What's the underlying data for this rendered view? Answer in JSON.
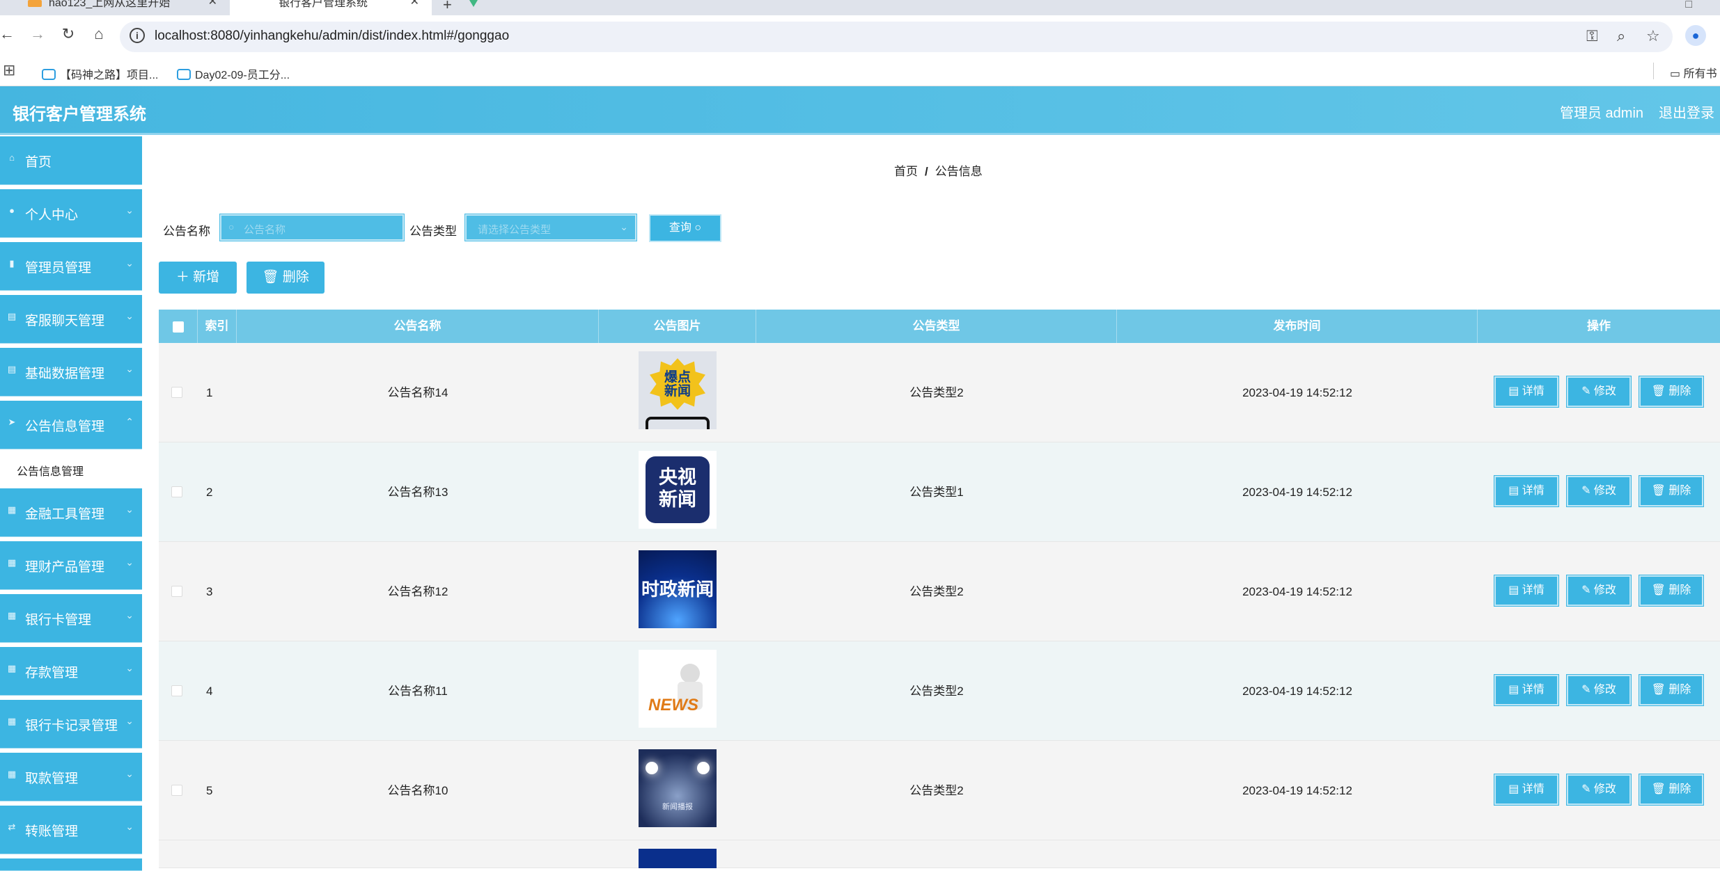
{
  "browser": {
    "tabs": [
      {
        "title": "hao123_上网从这里开始"
      },
      {
        "title": "银行客户管理系统"
      }
    ],
    "url": "localhost:8080/yinhangkehu/admin/dist/index.html#/gonggao",
    "bookmarks": [
      "【码神之路】项目...",
      "Day02-09-员工分..."
    ],
    "bookmarks_all": "所有书"
  },
  "header": {
    "title": "银行客户管理系统",
    "user": "管理员 admin",
    "logout": "退出登录"
  },
  "sidebar": {
    "items": [
      {
        "label": "首页",
        "icon": "home-icon"
      },
      {
        "label": "个人中心",
        "icon": "user-icon"
      },
      {
        "label": "管理员管理",
        "icon": "bar-chart-icon"
      },
      {
        "label": "客服聊天管理",
        "icon": "document-icon"
      },
      {
        "label": "基础数据管理",
        "icon": "document-icon"
      },
      {
        "label": "公告信息管理",
        "icon": "send-icon"
      },
      {
        "label": "金融工具管理",
        "icon": "grid-icon"
      },
      {
        "label": "理财产品管理",
        "icon": "grid-icon"
      },
      {
        "label": "银行卡管理",
        "icon": "grid-icon"
      },
      {
        "label": "存款管理",
        "icon": "grid-icon"
      },
      {
        "label": "银行卡记录管理",
        "icon": "grid-icon"
      },
      {
        "label": "取款管理",
        "icon": "grid-icon"
      },
      {
        "label": "转账管理",
        "icon": "transfer-icon"
      }
    ],
    "submenu": {
      "label": "公告信息管理"
    }
  },
  "breadcrumb": {
    "home": "首页",
    "separator": "/",
    "current": "公告信息"
  },
  "search": {
    "name_label": "公告名称",
    "name_placeholder": "公告名称",
    "type_label": "公告类型",
    "type_placeholder": "请选择公告类型",
    "query_label": "查询"
  },
  "toolbar": {
    "add_label": "新增",
    "delete_label": "删除"
  },
  "table": {
    "headers": [
      "索引",
      "公告名称",
      "公告图片",
      "公告类型",
      "发布时间",
      "操作"
    ],
    "rows": [
      {
        "index": "1",
        "name": "公告名称14",
        "image": "爆点新闻",
        "type": "公告类型2",
        "time": "2023-04-19 14:52:12"
      },
      {
        "index": "2",
        "name": "公告名称13",
        "image": "央视新闻",
        "type": "公告类型1",
        "time": "2023-04-19 14:52:12"
      },
      {
        "index": "3",
        "name": "公告名称12",
        "image": "时政新闻",
        "type": "公告类型2",
        "time": "2023-04-19 14:52:12"
      },
      {
        "index": "4",
        "name": "公告名称11",
        "image": "NEWS",
        "type": "公告类型2",
        "time": "2023-04-19 14:52:12"
      },
      {
        "index": "5",
        "name": "公告名称10",
        "image": "新闻播报",
        "type": "公告类型2",
        "time": "2023-04-19 14:52:12"
      }
    ],
    "actions": {
      "detail": "详情",
      "edit": "修改",
      "delete": "删除"
    }
  },
  "colors": {
    "primary": "#3cb5e2",
    "header": "#45b6e0",
    "table_header": "#6fc7e6"
  }
}
